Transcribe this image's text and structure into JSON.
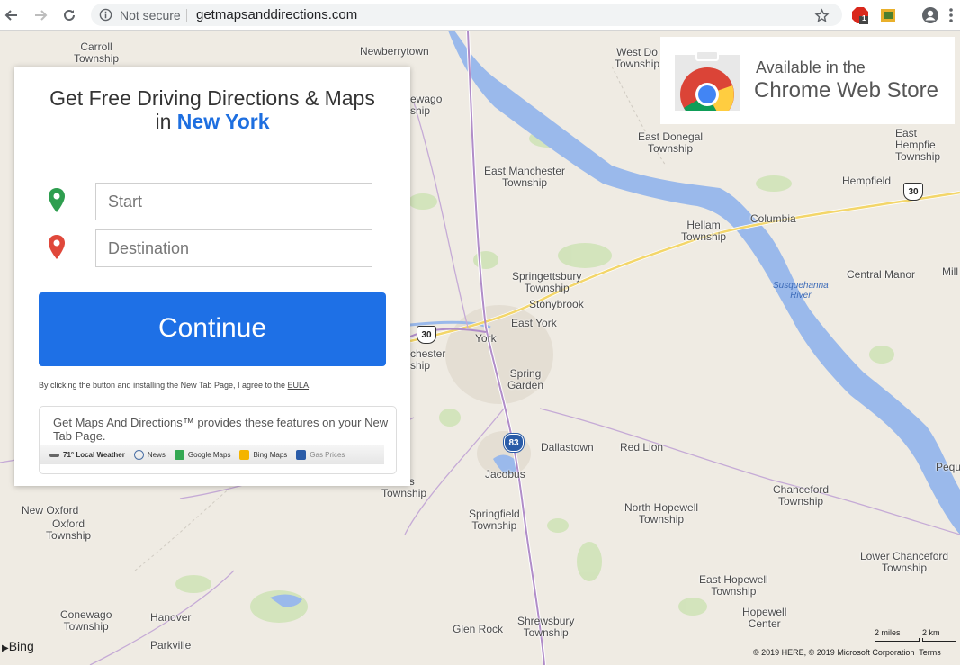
{
  "browser": {
    "security_label": "Not secure",
    "url": "getmapsanddirections.com",
    "ext_badge_count": "1"
  },
  "card": {
    "title_prefix": "Get Free Driving Directions & Maps",
    "title_in": "in",
    "title_city": "New York",
    "start_placeholder": "Start",
    "destination_placeholder": "Destination",
    "continue_label": "Continue",
    "disclaimer": "By clicking the button and installing the New Tab Page, I agree to the",
    "eula_label": "EULA",
    "disclaimer_end": ".",
    "features_text": "Get Maps And Directions™ provides these features on your New Tab Page.",
    "features": [
      {
        "label": "71° Local Weather",
        "icon": "weather-icon",
        "color": "#555555"
      },
      {
        "label": "News",
        "icon": "news-icon",
        "color": "#4a6fa5"
      },
      {
        "label": "Google Maps",
        "icon": "google-maps-icon",
        "color": "#34a853"
      },
      {
        "label": "Bing Maps",
        "icon": "bing-maps-icon",
        "color": "#f4b400"
      },
      {
        "label": "Gas Prices",
        "icon": "gas-prices-icon",
        "color": "#2a5ca8"
      }
    ],
    "accent_color": "#1e70e6",
    "start_pin_color": "#2e9e4f",
    "destination_pin_color": "#e0483b"
  },
  "store_badge": {
    "line1": "Available in the",
    "line2": "Chrome Web Store"
  },
  "map": {
    "places": [
      "Carroll\nTownship",
      "Newberrytown",
      "West Do\nTownship",
      "ewago\nship",
      "East Donegal\nTownship",
      "East Hempfie\nTownship",
      "East Manchester\nTownship",
      "Hempfield",
      "Hellam\nTownship",
      "Columbia",
      "Springettsbury\nTownship",
      "Stonybrook",
      "Central Manor",
      "Mill",
      "East York",
      "York",
      "chester\nship",
      "Spring\nGarden",
      "Dallastown",
      "Red Lion",
      "Jacobus",
      "Pequ",
      "odorus\nTownship",
      "New Oxford",
      "Oxford\nTownship",
      "Springfield\nTownship",
      "North Hopewell\nTownship",
      "Chanceford\nTownship",
      "Lower Chanceford\nTownship",
      "East Hopewell\nTownship",
      "Conewago\nTownship",
      "Hanover",
      "Parkville",
      "Glen Rock",
      "Shrewsbury\nTownship",
      "Hopewell\nCenter"
    ],
    "river_label": "Susquehanna\nRiver",
    "shields": [
      {
        "label": "30",
        "type": "us"
      },
      {
        "label": "30",
        "type": "us"
      },
      {
        "label": "83",
        "type": "interstate"
      }
    ],
    "attribution_logo": "Bing",
    "scale_miles": "2 miles",
    "scale_km": "2 km",
    "copyright": "© 2019 HERE, © 2019 Microsoft Corporation",
    "terms_label": "Terms"
  }
}
